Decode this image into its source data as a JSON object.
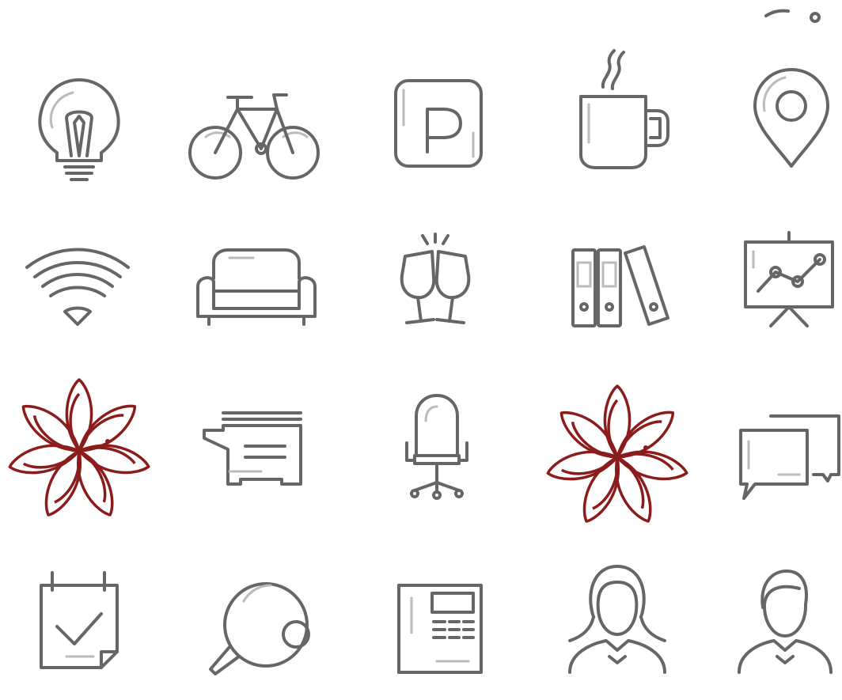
{
  "colors": {
    "background": "#ffffff",
    "line_icon": "#666666",
    "accent_flower": "#8b1c1c"
  },
  "icons": [
    {
      "name": "lightbulb-icon"
    },
    {
      "name": "bicycle-icon"
    },
    {
      "name": "parking-icon",
      "text": "P"
    },
    {
      "name": "coffee-mug-icon"
    },
    {
      "name": "map-pin-icon"
    },
    {
      "name": "wifi-icon"
    },
    {
      "name": "sofa-icon"
    },
    {
      "name": "champagne-toast-icon"
    },
    {
      "name": "binders-icon"
    },
    {
      "name": "presentation-chart-icon"
    },
    {
      "name": "flower-logo-icon"
    },
    {
      "name": "printer-icon"
    },
    {
      "name": "office-chair-icon"
    },
    {
      "name": "flower-logo-icon"
    },
    {
      "name": "chat-bubbles-icon"
    },
    {
      "name": "calendar-check-icon"
    },
    {
      "name": "ping-pong-icon"
    },
    {
      "name": "desk-phone-icon"
    },
    {
      "name": "woman-avatar-icon"
    },
    {
      "name": "man-avatar-icon"
    }
  ]
}
